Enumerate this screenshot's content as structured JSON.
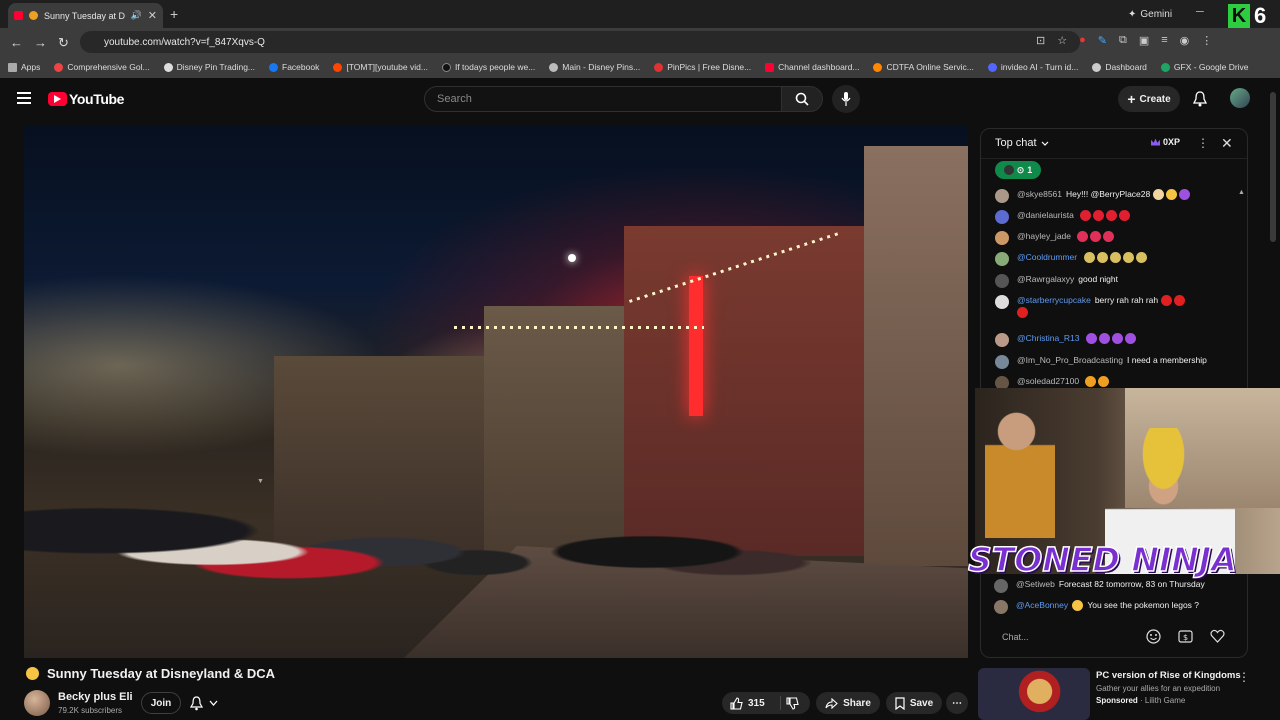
{
  "browser": {
    "tab_title": "Sunny Tuesday at Disne",
    "url": "youtube.com/watch?v=f_847Xqvs-Q",
    "gemini_label": "Gemini",
    "k6_letter": "K",
    "k6_number": "6",
    "bookmarks": [
      "Apps",
      "Comprehensive Gol...",
      "Disney Pin Trading...",
      "Facebook",
      "[TOMT][youtube vid...",
      "If todays people we...",
      "Main - Disney Pins...",
      "PinPics | Free Disne...",
      "Channel dashboard...",
      "CDTFA Online Servic...",
      "invideo AI - Turn id...",
      "Dashboard",
      "GFX - Google Drive"
    ]
  },
  "youtube": {
    "logo_text": "YouTube",
    "search_placeholder": "Search",
    "create_label": "Create"
  },
  "video": {
    "title": "Sunny Tuesday at Disneyland & DCA",
    "channel_name": "Becky plus Eli",
    "subscribers": "79.2K subscribers",
    "join_label": "Join",
    "likes": "315",
    "share_label": "Share",
    "save_label": "Save"
  },
  "chat": {
    "header": "Top chat",
    "xp": "0XP",
    "viewer_count": "1",
    "messages": [
      {
        "user": "@skye8561",
        "text": "Hey!!! @BerryPlace28",
        "blue": false
      },
      {
        "user": "@danielaurista",
        "text": "",
        "blue": false
      },
      {
        "user": "@hayley_jade",
        "text": "",
        "blue": false
      },
      {
        "user": "@Cooldrummer",
        "text": "",
        "blue": true
      },
      {
        "user": "@Rawrgalaxyy",
        "text": "good night",
        "blue": false
      },
      {
        "user": "@starberrycupcake",
        "text": "berry rah rah rah",
        "blue": true
      },
      {
        "user": "@Christina_R13",
        "text": "",
        "blue": true
      },
      {
        "user": "@Im_No_Pro_Broadcasting",
        "text": "I need a membership",
        "blue": false
      },
      {
        "user": "@soledad27100",
        "text": "",
        "blue": false
      },
      {
        "user": "@Setiweb",
        "text": "Forecast 82 tomorrow, 83 on Thursday",
        "blue": false
      },
      {
        "user": "@AceBonney",
        "text": "You see the pokemon legos ?",
        "blue": true
      }
    ],
    "input_placeholder": "Chat...",
    "overlay_text": "STONED NINJA"
  },
  "ad": {
    "title": "PC version of Rise of Kingdoms",
    "subtitle": "Gather your allies for an expedition",
    "sponsored": "Sponsored",
    "advertiser": "Lilith Game"
  }
}
